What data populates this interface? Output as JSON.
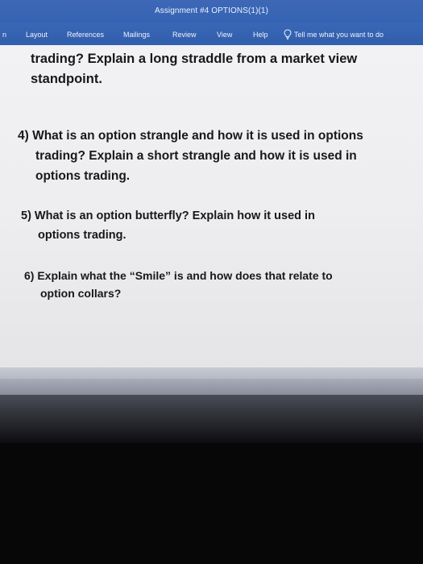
{
  "window": {
    "title": "Assignment #4 OPTIONS(1)(1)"
  },
  "ribbon": {
    "tabs": [
      {
        "label": "n"
      },
      {
        "label": "Layout"
      },
      {
        "label": "References"
      },
      {
        "label": "Mailings"
      },
      {
        "label": "Review"
      },
      {
        "label": "View"
      },
      {
        "label": "Help"
      }
    ],
    "tell_me": {
      "label": "Tell me what you want to do",
      "icon": "lightbulb-icon"
    }
  },
  "document": {
    "blocks": [
      {
        "lines": [
          "trading? Explain a long straddle from a market view",
          "standpoint."
        ]
      },
      {
        "lines": [
          "4)  What is an option strangle and how it is used in options",
          "trading? Explain a short strangle and how it is used in",
          "options trading."
        ]
      },
      {
        "lines": [
          "5) What is an option butterfly? Explain how it used in",
          "options trading."
        ]
      },
      {
        "lines": [
          "6)  Explain what the “Smile”  is and how does that relate to",
          "option collars?"
        ]
      }
    ]
  },
  "colors": {
    "ribbon": "#3563b3",
    "page": "#efeff1",
    "text": "#181818",
    "background": "#070707"
  }
}
